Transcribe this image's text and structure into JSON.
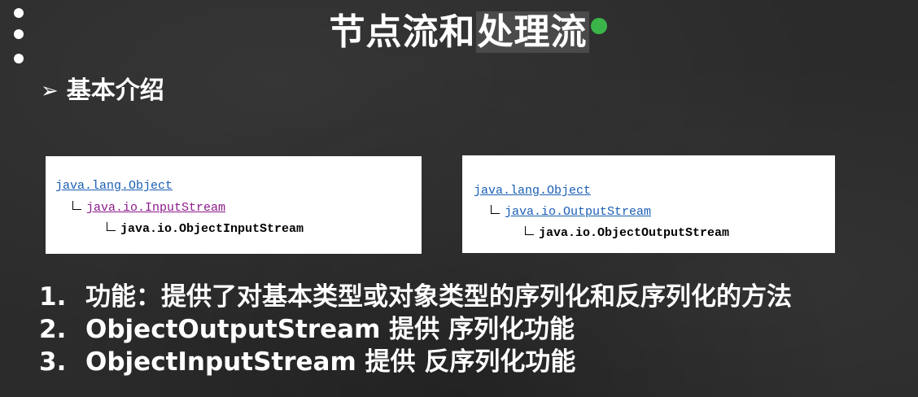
{
  "slide": {
    "title_part1": "节点流和",
    "title_part2": "处理流",
    "section_arrow": "➢",
    "section_label": "基本介绍"
  },
  "panels": [
    {
      "root": "java.lang.Object",
      "parent": "java.io.InputStream",
      "class": "java.io.ObjectInputStream"
    },
    {
      "root": "java.lang.Object",
      "parent": "java.io.OutputStream",
      "class": "java.io.ObjectOutputStream"
    }
  ],
  "list": [
    {
      "num": "1.",
      "text": "功能：提供了对基本类型或对象类型的序列化和反序列化的方法"
    },
    {
      "num": "2.",
      "text": "ObjectOutputStream 提供 序列化功能"
    },
    {
      "num": "3.",
      "text": "ObjectInputStream 提供 反序列化功能"
    }
  ],
  "colors": {
    "background": "#2b2b2b",
    "link_blue": "#1a5fb4",
    "link_purple": "#8b1a8b",
    "cursor_green": "#3bb54a"
  }
}
